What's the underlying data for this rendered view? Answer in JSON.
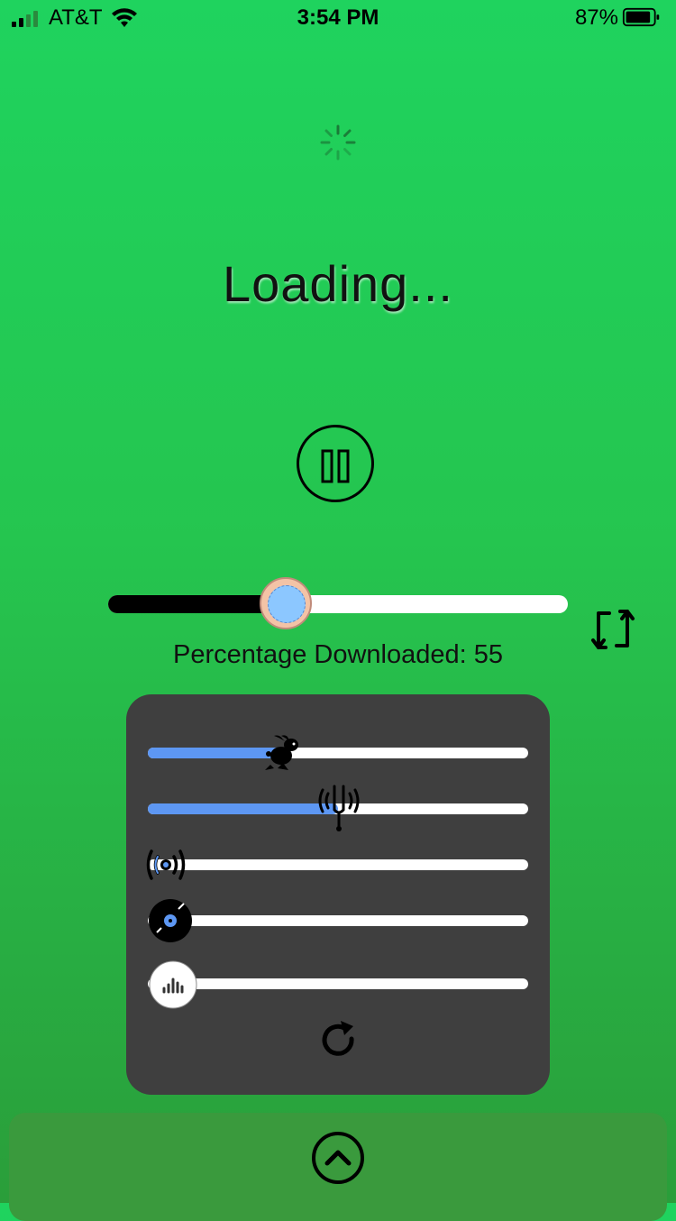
{
  "status_bar": {
    "carrier": "AT&T",
    "time": "3:54 PM",
    "battery_percent": "87%",
    "signal_icon": "signal-bars-icon",
    "wifi_icon": "wifi-icon",
    "battery_icon": "battery-icon"
  },
  "loading": {
    "spinner_icon": "activity-spinner-icon",
    "title": "Loading..."
  },
  "controls": {
    "pause_icon": "pause-icon",
    "download_progress": 0.55,
    "percentage_label": "Percentage Downloaded: 55",
    "repeat_icon": "repeat-icon"
  },
  "panel": {
    "sliders": [
      {
        "name": "rabbit-slider",
        "icon": "rabbit-icon",
        "value": 0.35
      },
      {
        "name": "tuning-fork-slider",
        "icon": "tuning-fork-icon",
        "value": 0.5
      },
      {
        "name": "broadcast-slider",
        "icon": "broadcast-icon",
        "value": 0.0
      },
      {
        "name": "vinyl-slider",
        "icon": "vinyl-record-icon",
        "value": 0.0
      },
      {
        "name": "equalizer-slider",
        "icon": "equalizer-icon",
        "value": 0.0
      }
    ],
    "reset_icon": "reset-icon"
  },
  "drawer": {
    "expand_icon": "chevron-up-icon"
  },
  "colors": {
    "background_top": "#1fd35e",
    "background_bottom": "#2a9e3a",
    "panel": "#3f3f3f",
    "slider_fill": "#5d97f3",
    "drawer": "#3a9a3d"
  }
}
